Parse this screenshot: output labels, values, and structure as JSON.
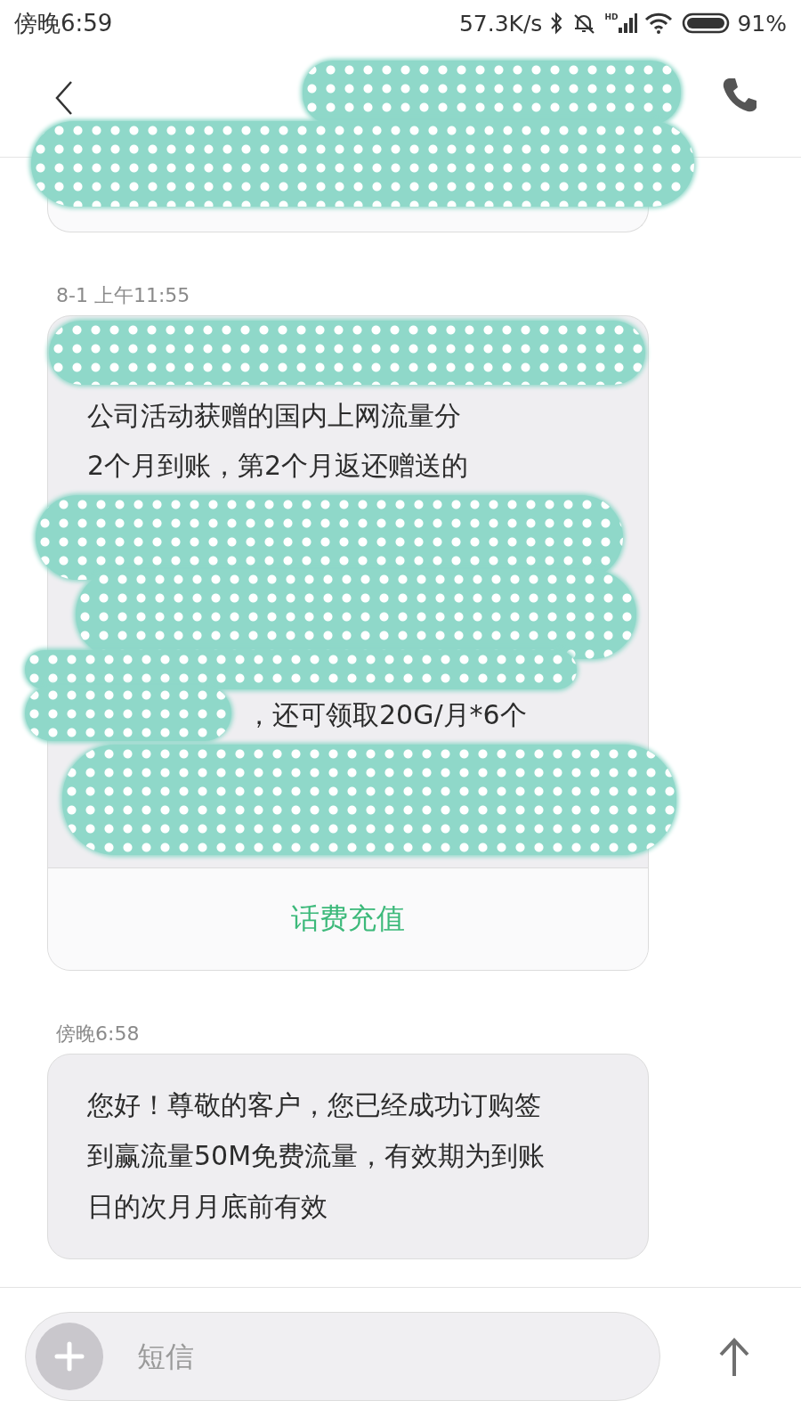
{
  "status_bar": {
    "time": "傍晚6:59",
    "speed": "57.3K/s",
    "signal_label": "HD",
    "battery": "91%"
  },
  "messages": [
    {
      "kind": "cut"
    },
    {
      "kind": "card",
      "time": "8-1 上午11:55",
      "lines": [
        {
          "kind": "covered"
        },
        {
          "kind": "line",
          "text": "公司活动获赠的国内上网流量分"
        },
        {
          "kind": "line",
          "text": "2个月到账，第2个月返还赠送的"
        },
        {
          "kind": "covered"
        },
        {
          "kind": "covered"
        },
        {
          "kind": "covered"
        },
        {
          "kind": "covered"
        },
        {
          "kind": "partial",
          "text": "，还可领取20G/月*6个"
        },
        {
          "kind": "covered"
        },
        {
          "kind": "covered"
        }
      ],
      "action": "话费充值"
    },
    {
      "kind": "text",
      "time": "傍晚6:58",
      "lines": [
        {
          "kind": "line",
          "text": "您好！尊敬的客户，您已经成功订购签"
        },
        {
          "kind": "line",
          "text": "到赢流量50M免费流量，有效期为到账"
        },
        {
          "kind": "line",
          "text": "日的次月月底前有效"
        }
      ]
    }
  ],
  "composer": {
    "placeholder": "短信"
  }
}
